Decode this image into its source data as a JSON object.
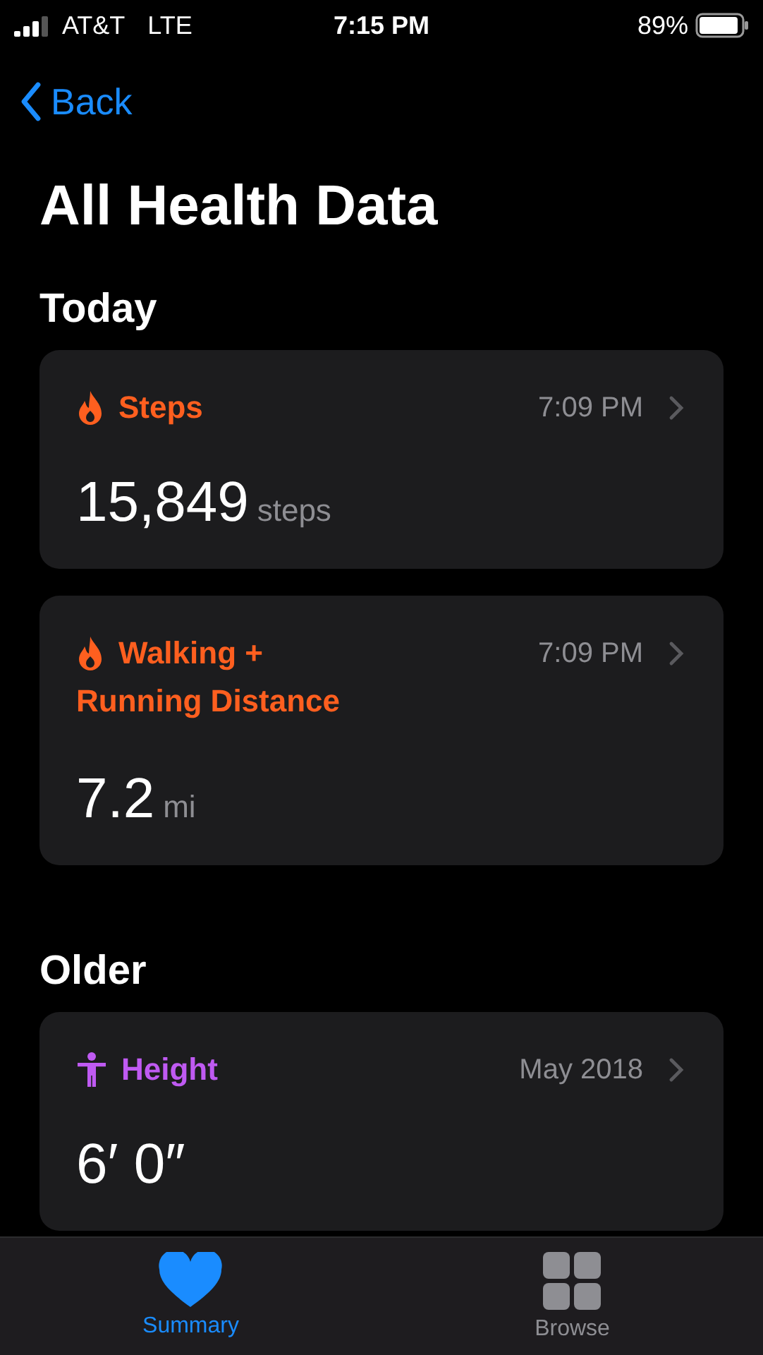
{
  "status_bar": {
    "carrier": "AT&T",
    "network": "LTE",
    "time": "7:15 PM",
    "battery": "89%"
  },
  "nav": {
    "back": "Back"
  },
  "title": "All Health Data",
  "sections": [
    {
      "header": "Today",
      "cards": [
        {
          "kind": "flame",
          "color": "#ff5f1f",
          "title_lines": [
            "Steps"
          ],
          "time": "7:09 PM",
          "value": "15,849",
          "unit": "steps"
        },
        {
          "kind": "flame",
          "color": "#ff5f1f",
          "title_lines": [
            "Walking +",
            "Running Distance"
          ],
          "time": "7:09 PM",
          "value": "7.2",
          "unit": "mi"
        }
      ]
    },
    {
      "header": "Older",
      "cards": [
        {
          "kind": "figure",
          "color": "#bf5af2",
          "title_lines": [
            "Height"
          ],
          "time": "May 2018",
          "value": "6′ 0″"
        }
      ]
    }
  ],
  "tabs": [
    {
      "label": "Summary",
      "kind": "heart",
      "selected": true
    },
    {
      "label": "Browse",
      "kind": "grid",
      "selected": false
    }
  ]
}
